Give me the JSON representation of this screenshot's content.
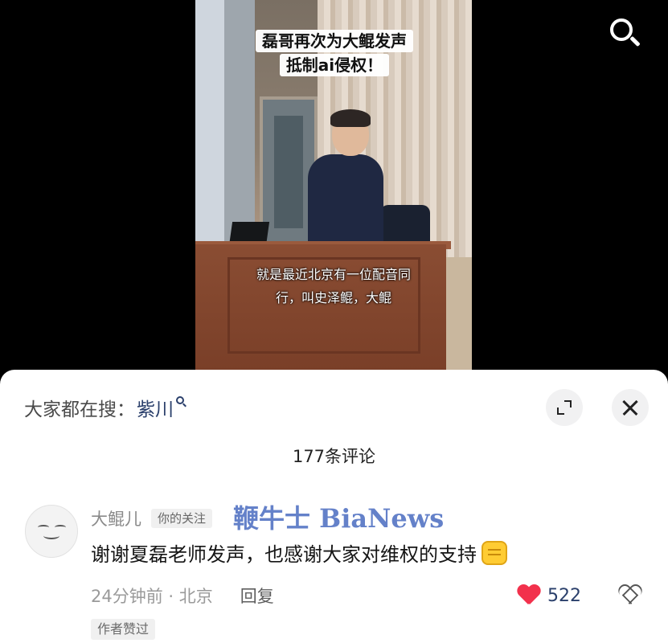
{
  "video": {
    "title_line1": "磊哥再次为大鲲发声",
    "title_line2": "抵制ai侵权！",
    "subtitle_line1": "就是最近北京有一位配音同",
    "subtitle_line2": "行，叫史泽鲲，大鲲"
  },
  "top_bar": {
    "search_icon": "search-icon"
  },
  "comments_panel": {
    "hot_search_label": "大家都在搜：",
    "hot_search_term": "紫川",
    "expand_icon": "expand-icon",
    "close_icon": "close-icon",
    "count_text": "177条评论",
    "watermark": "鞭牛士 BiaNews",
    "comments": [
      {
        "author": "大鲲儿",
        "follow_tag": "你的关注",
        "text": "谢谢夏磊老师发声，也感谢大家对维权的支持",
        "emoji": "fist-emoji",
        "time_location": "24分钟前 · 北京",
        "reply_label": "回复",
        "likes": "522",
        "like_color": "#f2314c",
        "author_liked_tag": "作者赞过"
      }
    ]
  }
}
